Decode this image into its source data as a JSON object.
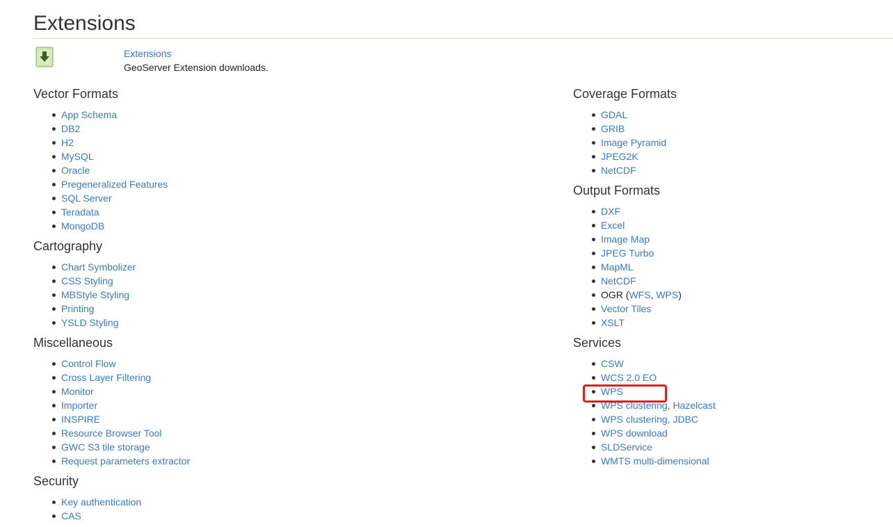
{
  "page": {
    "title": "Extensions",
    "intro": {
      "icon": "download-arrow-icon",
      "link_label": "Extensions",
      "description": "GeoServer Extension downloads."
    }
  },
  "left_column": [
    {
      "heading": "Vector Formats",
      "items": [
        "App Schema",
        "DB2",
        "H2",
        "MySQL",
        "Oracle",
        "Pregeneralized Features",
        "SQL Server",
        "Teradata",
        "MongoDB"
      ]
    },
    {
      "heading": "Cartography",
      "items": [
        "Chart Symbolizer",
        "CSS Styling",
        "MBStyle Styling",
        "Printing",
        "YSLD Styling"
      ]
    },
    {
      "heading": "Miscellaneous",
      "items": [
        "Control Flow",
        "Cross Layer Filtering",
        "Monitor",
        "Importer",
        "INSPIRE",
        "Resource Browser Tool",
        "GWC S3 tile storage",
        "Request parameters extractor"
      ]
    },
    {
      "heading": "Security",
      "items": [
        "Key authentication",
        "CAS"
      ]
    }
  ],
  "right_column": [
    {
      "heading": "Coverage Formats",
      "items": [
        "GDAL",
        "GRIB",
        "Image Pyramid",
        "JPEG2K",
        "NetCDF"
      ]
    },
    {
      "heading": "Output Formats",
      "items": [
        "DXF",
        "Excel",
        "Image Map",
        "JPEG Turbo",
        "MapML",
        "NetCDF",
        "OGR",
        "Vector Tiles",
        "XSLT"
      ],
      "ogr_detail": {
        "prefix": "OGR (",
        "links": [
          "WFS",
          "WPS"
        ],
        "separator": ", ",
        "suffix": ")"
      }
    },
    {
      "heading": "Services",
      "items": [
        "CSW",
        "WCS 2.0 EO",
        "WPS",
        "WPS clustering, Hazelcast",
        "WPS clustering, JDBC",
        "WPS download",
        "SLDService",
        "WMTS multi-dimensional"
      ]
    }
  ],
  "colors": {
    "link": "#3a7bbf",
    "heading": "#333333",
    "highlight_border": "#e01e1e",
    "rule": "#d0d7c0",
    "icon_fill": "#b5d98a"
  }
}
